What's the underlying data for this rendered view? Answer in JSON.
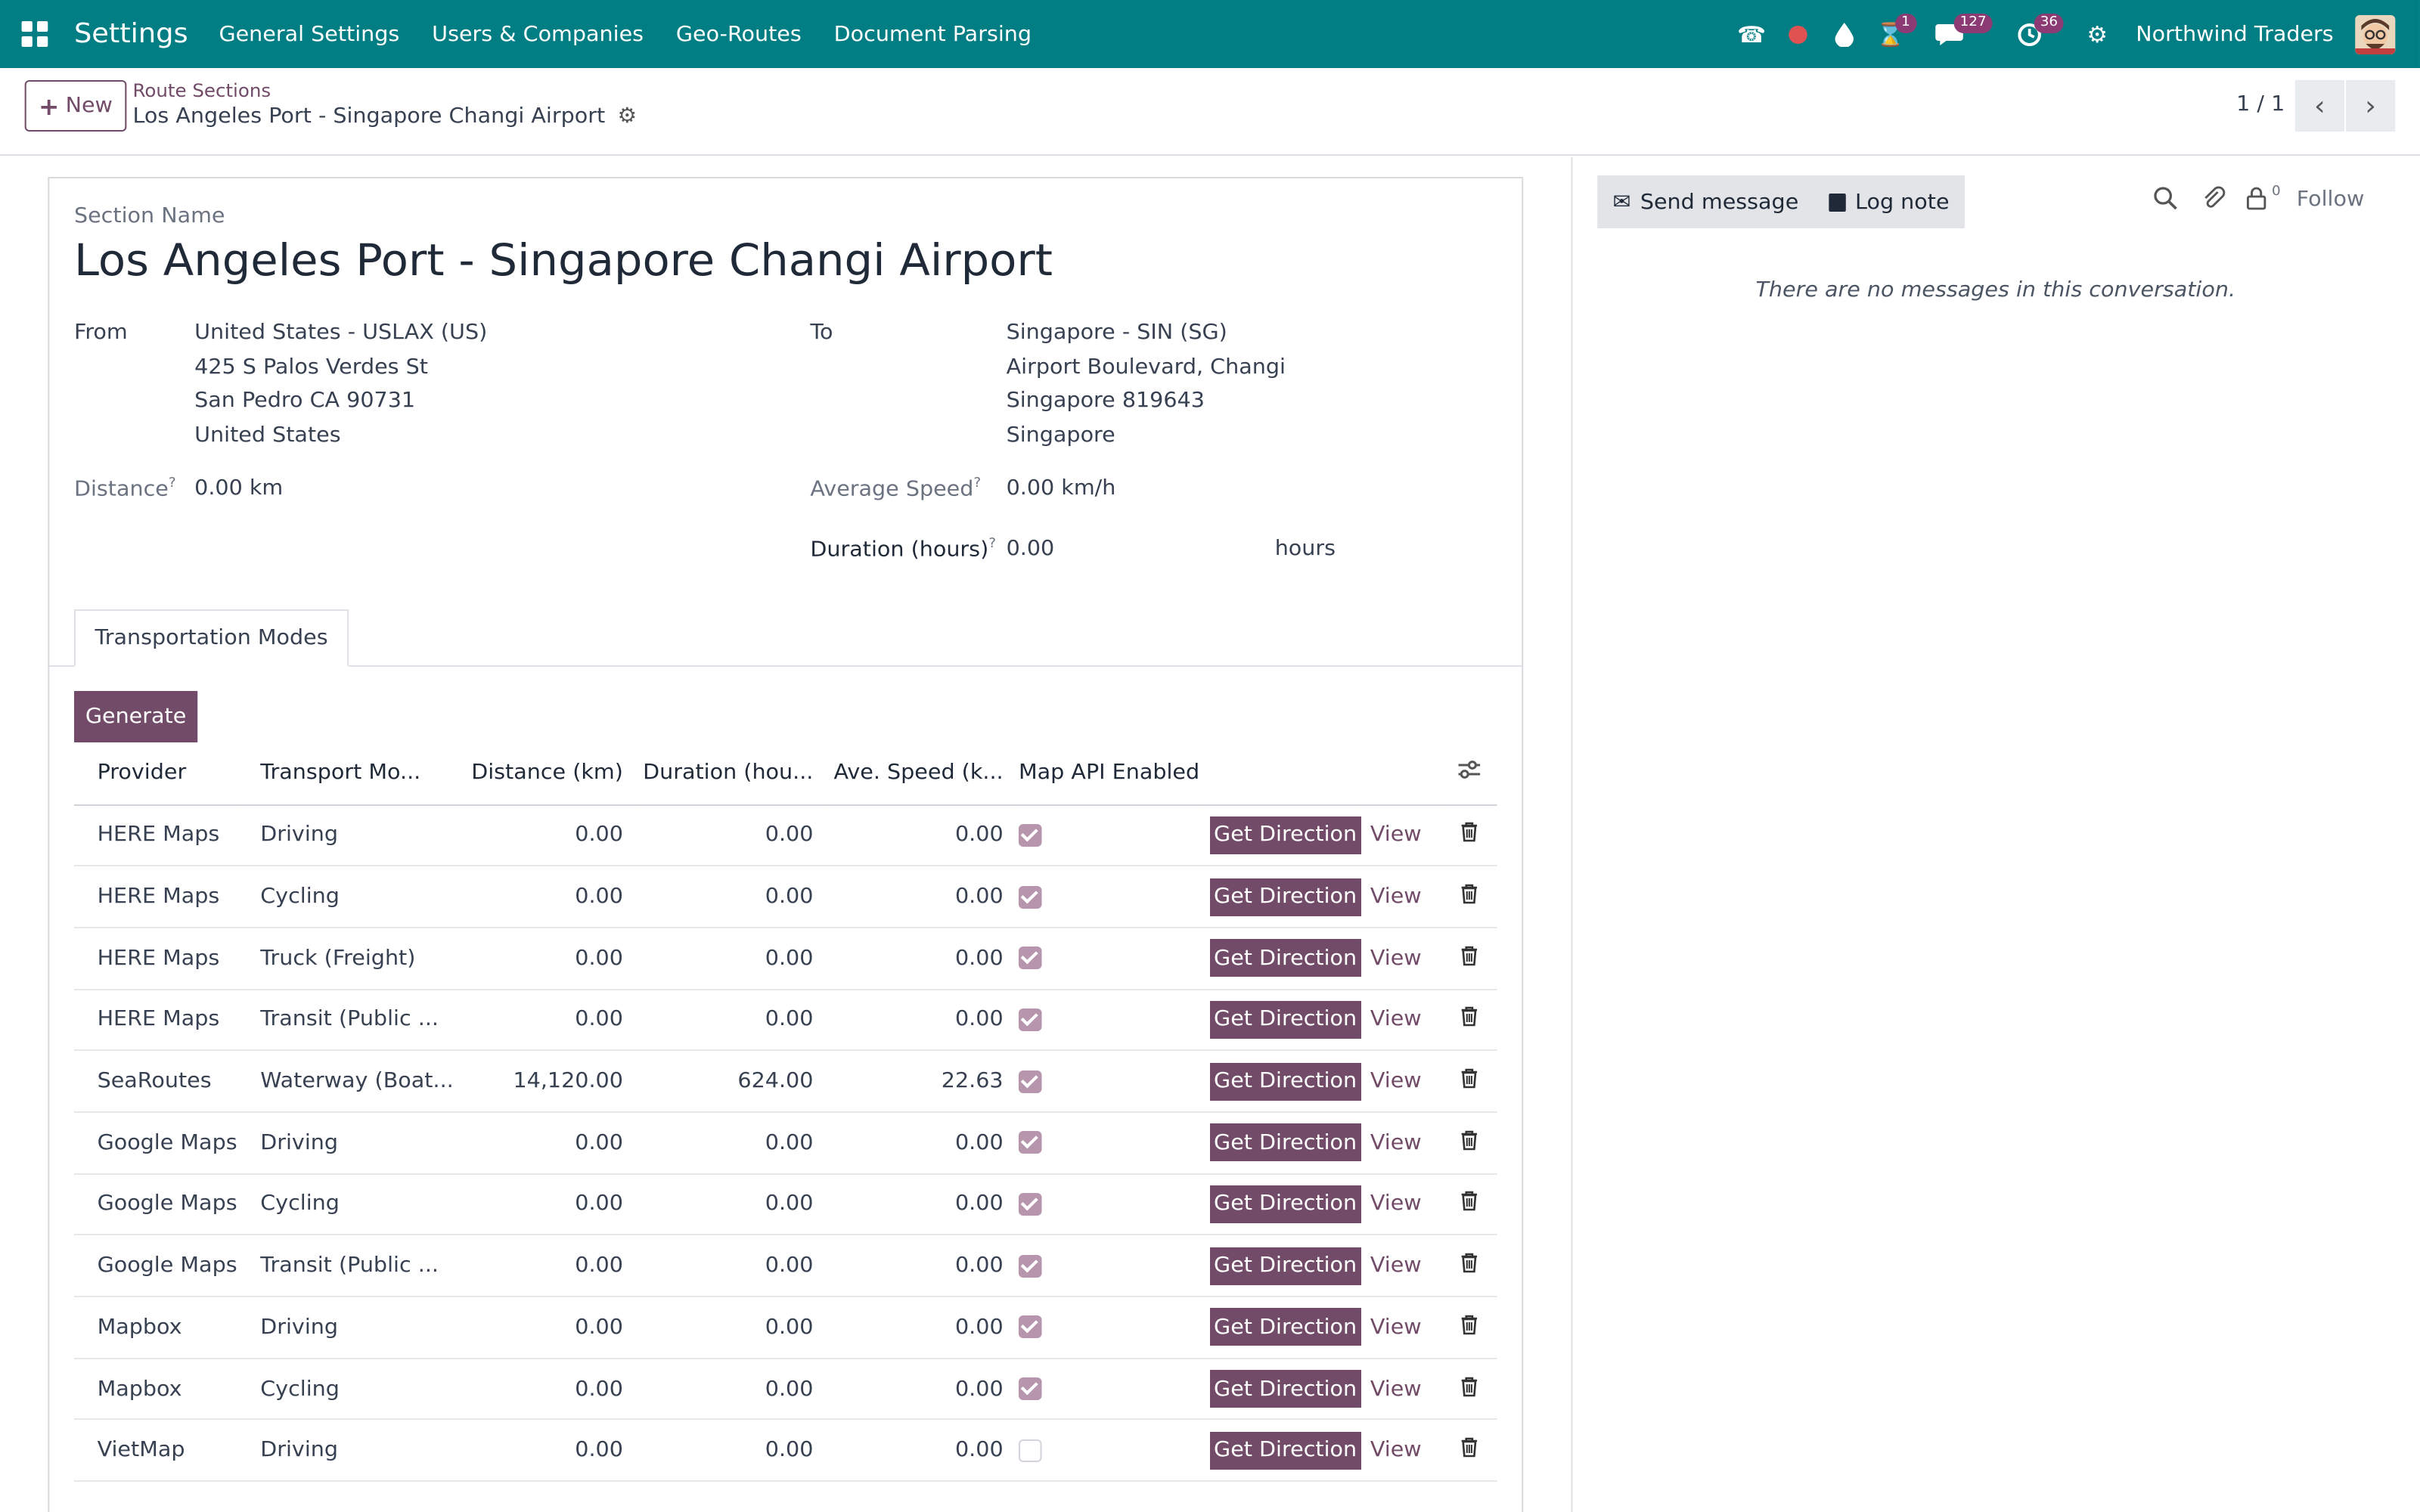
{
  "navbar": {
    "brand": "Settings",
    "menu": [
      "General Settings",
      "Users & Companies",
      "Geo-Routes",
      "Document Parsing"
    ],
    "activity_badge": "1",
    "messages_badge": "127",
    "clock_badge": "36",
    "company": "Northwind Traders"
  },
  "control": {
    "new_label": "New",
    "breadcrumb_parent": "Route Sections",
    "breadcrumb_current": "Los Angeles Port - Singapore Changi Airport",
    "pager": "1 / 1"
  },
  "form": {
    "section_name_label": "Section Name",
    "section_name": "Los Angeles Port - Singapore Changi Airport",
    "from_label": "From",
    "from_lines": [
      "United States - USLAX (US)",
      "425 S Palos Verdes St",
      "San Pedro CA 90731",
      "United States"
    ],
    "to_label": "To",
    "to_lines": [
      "Singapore - SIN (SG)",
      "Airport Boulevard, Changi",
      "Singapore 819643",
      "Singapore"
    ],
    "distance_label": "Distance",
    "distance_value": "0.00 km",
    "avg_speed_label": "Average Speed",
    "avg_speed_value": "0.00 km/h",
    "duration_label": "Duration (hours)",
    "duration_value": "0.00",
    "duration_unit": "hours",
    "help_mark": "?"
  },
  "tabs": {
    "transport": "Transportation Modes"
  },
  "generate_label": "Generate",
  "table": {
    "headers": [
      "Provider",
      "Transport Mo...",
      "Distance (km)",
      "Duration (hou...",
      "Ave. Speed (k...",
      "Map API Enabled"
    ],
    "get_direction_label": "Get Direction",
    "view_label": "View",
    "rows": [
      {
        "provider": "HERE Maps",
        "mode": "Driving",
        "distance": "0.00",
        "duration": "0.00",
        "speed": "0.00",
        "api": true
      },
      {
        "provider": "HERE Maps",
        "mode": "Cycling",
        "distance": "0.00",
        "duration": "0.00",
        "speed": "0.00",
        "api": true
      },
      {
        "provider": "HERE Maps",
        "mode": "Truck (Freight)",
        "distance": "0.00",
        "duration": "0.00",
        "speed": "0.00",
        "api": true
      },
      {
        "provider": "HERE Maps",
        "mode": "Transit (Public ...",
        "distance": "0.00",
        "duration": "0.00",
        "speed": "0.00",
        "api": true
      },
      {
        "provider": "SeaRoutes",
        "mode": "Waterway (Boat...",
        "distance": "14,120.00",
        "duration": "624.00",
        "speed": "22.63",
        "api": true
      },
      {
        "provider": "Google Maps",
        "mode": "Driving",
        "distance": "0.00",
        "duration": "0.00",
        "speed": "0.00",
        "api": true
      },
      {
        "provider": "Google Maps",
        "mode": "Cycling",
        "distance": "0.00",
        "duration": "0.00",
        "speed": "0.00",
        "api": true
      },
      {
        "provider": "Google Maps",
        "mode": "Transit (Public ...",
        "distance": "0.00",
        "duration": "0.00",
        "speed": "0.00",
        "api": true
      },
      {
        "provider": "Mapbox",
        "mode": "Driving",
        "distance": "0.00",
        "duration": "0.00",
        "speed": "0.00",
        "api": true
      },
      {
        "provider": "Mapbox",
        "mode": "Cycling",
        "distance": "0.00",
        "duration": "0.00",
        "speed": "0.00",
        "api": true
      },
      {
        "provider": "VietMap",
        "mode": "Driving",
        "distance": "0.00",
        "duration": "0.00",
        "speed": "0.00",
        "api": false
      }
    ]
  },
  "chatter": {
    "send_message": "Send message",
    "log_note": "Log note",
    "followers_count": "0",
    "follow": "Follow",
    "empty": "There are no messages in this conversation."
  },
  "colors": {
    "navbar": "#017e84",
    "primary": "#714b67",
    "badge": "#8c3a74"
  }
}
